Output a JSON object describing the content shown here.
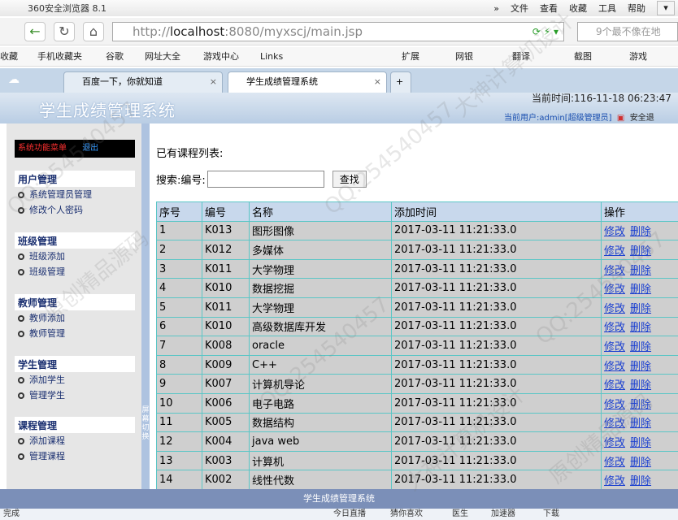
{
  "browser": {
    "app_title": "360安全浏览器 8.1",
    "menu": [
      "»",
      "文件",
      "查看",
      "收藏",
      "工具",
      "帮助"
    ],
    "url_prefix": "http://",
    "url_host": "localhost",
    "url_rest": ":8080/myxscj/main.jsp",
    "search_placeholder": "9个最不像在地",
    "bookmarks": [
      "收藏",
      "手机收藏夹",
      "谷歌",
      "网址大全",
      "游戏中心",
      "Links",
      "扩展",
      "网银",
      "翻译",
      "截图",
      "游戏"
    ],
    "tabs": [
      {
        "label": "百度一下，你就知道"
      },
      {
        "label": "学生成绩管理系统"
      }
    ]
  },
  "header": {
    "system_name": "学生成绩管理系统",
    "time_text": "当前时间:116-11-18 06:23:47",
    "user_text": "当前用户:admin[超级管理员]",
    "exit_text": "安全退"
  },
  "sidebar": {
    "menu_title": "系统功能菜单",
    "menu_extra": "退出",
    "groups": [
      {
        "title": "用户管理",
        "items": [
          "系统管理员管理",
          "修改个人密码"
        ]
      },
      {
        "title": "班级管理",
        "items": [
          "班级添加",
          "班级管理"
        ]
      },
      {
        "title": "教师管理",
        "items": [
          "教师添加",
          "教师管理"
        ]
      },
      {
        "title": "学生管理",
        "items": [
          "添加学生",
          "管理学生"
        ]
      },
      {
        "title": "课程管理",
        "items": [
          "添加课程",
          "管理课程"
        ]
      }
    ],
    "splitter_text": "屏幕切换"
  },
  "main": {
    "list_title": "已有课程列表:",
    "search_label": "搜索:编号:",
    "search_value": "",
    "search_button": "查找",
    "columns": [
      "序号",
      "编号",
      "名称",
      "添加时间",
      "操作"
    ],
    "edit_label": "修改",
    "delete_label": "删除",
    "rows": [
      {
        "no": "1",
        "code": "K013",
        "name": "图形图像",
        "time": "2017-03-11 11:21:33.0"
      },
      {
        "no": "2",
        "code": "K012",
        "name": "多媒体",
        "time": "2017-03-11 11:21:33.0"
      },
      {
        "no": "3",
        "code": "K011",
        "name": "大学物理",
        "time": "2017-03-11 11:21:33.0"
      },
      {
        "no": "4",
        "code": "K010",
        "name": "数据挖掘",
        "time": "2017-03-11 11:21:33.0"
      },
      {
        "no": "5",
        "code": "K011",
        "name": "大学物理",
        "time": "2017-03-11 11:21:33.0"
      },
      {
        "no": "6",
        "code": "K010",
        "name": "高级数据库开发",
        "time": "2017-03-11 11:21:33.0"
      },
      {
        "no": "7",
        "code": "K008",
        "name": "oracle",
        "time": "2017-03-11 11:21:33.0"
      },
      {
        "no": "8",
        "code": "K009",
        "name": "C++",
        "time": "2017-03-11 11:21:33.0"
      },
      {
        "no": "9",
        "code": "K007",
        "name": "计算机导论",
        "time": "2017-03-11 11:21:33.0"
      },
      {
        "no": "10",
        "code": "K006",
        "name": "电子电路",
        "time": "2017-03-11 11:21:33.0"
      },
      {
        "no": "11",
        "code": "K005",
        "name": "数据结构",
        "time": "2017-03-11 11:21:33.0"
      },
      {
        "no": "12",
        "code": "K004",
        "name": "java web",
        "time": "2017-03-11 11:21:33.0"
      },
      {
        "no": "13",
        "code": "K003",
        "name": "计算机",
        "time": "2017-03-11 11:21:33.0"
      },
      {
        "no": "14",
        "code": "K002",
        "name": "线性代数",
        "time": "2017-03-11 11:21:33.0"
      }
    ]
  },
  "footer": {
    "text": "学生成绩管理系统"
  },
  "statusbar": {
    "left": "完成",
    "items": [
      "今日直播",
      "猜你喜欢",
      "医生",
      "加速器",
      "下载"
    ]
  },
  "watermarks": [
    "QQ:254540457",
    "大神计算机设计",
    "原创精品源码"
  ]
}
